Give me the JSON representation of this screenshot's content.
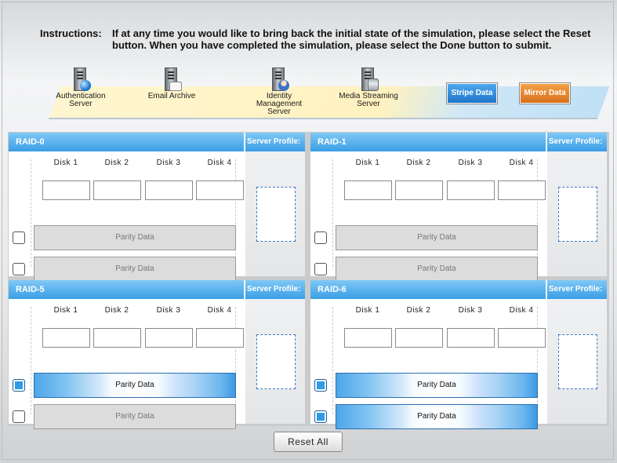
{
  "instructions": {
    "label": "Instructions:",
    "text": "If at any time you would like to bring back the initial state of the simulation, please select the Reset button. When you have completed the simulation, please select the Done button to submit."
  },
  "servers": [
    {
      "name": "Authentication Server",
      "icon": "globe-server-icon"
    },
    {
      "name": "Email Archive",
      "icon": "mail-server-icon"
    },
    {
      "name": "Identity Management Server",
      "icon": "user-server-icon"
    },
    {
      "name": "Media Streaming Server",
      "icon": "database-server-icon"
    }
  ],
  "buttons": {
    "stripe": "Stripe Data",
    "mirror": "Mirror Data",
    "reset": "Reset All"
  },
  "colors": {
    "panel_header": "#3a9ee6",
    "stripe_button": "#1f76c8",
    "mirror_button": "#d7711b",
    "checked": "#2f9be6"
  },
  "panels": [
    {
      "title": "RAID-0",
      "profile": "Server Profile:",
      "disks": [
        "Disk 1",
        "Disk 2",
        "Disk 3",
        "Disk 4"
      ],
      "rows": [
        {
          "label": "Parity Data",
          "checked": false,
          "filled": false
        },
        {
          "label": "Parity Data",
          "checked": false,
          "filled": false
        }
      ]
    },
    {
      "title": "RAID-1",
      "profile": "Server Profile:",
      "disks": [
        "Disk 1",
        "Disk 2",
        "Disk 3",
        "Disk 4"
      ],
      "rows": [
        {
          "label": "Parity Data",
          "checked": false,
          "filled": false
        },
        {
          "label": "Parity Data",
          "checked": false,
          "filled": false
        }
      ]
    },
    {
      "title": "RAID-5",
      "profile": "Server Profile:",
      "disks": [
        "Disk 1",
        "Disk 2",
        "Disk 3",
        "Disk 4"
      ],
      "rows": [
        {
          "label": "Parity Data",
          "checked": true,
          "filled": true
        },
        {
          "label": "Parity Data",
          "checked": false,
          "filled": false
        }
      ]
    },
    {
      "title": "RAID-6",
      "profile": "Server Profile:",
      "disks": [
        "Disk 1",
        "Disk 2",
        "Disk 3",
        "Disk 4"
      ],
      "rows": [
        {
          "label": "Parity Data",
          "checked": true,
          "filled": true
        },
        {
          "label": "Parity Data",
          "checked": true,
          "filled": true
        }
      ]
    }
  ]
}
